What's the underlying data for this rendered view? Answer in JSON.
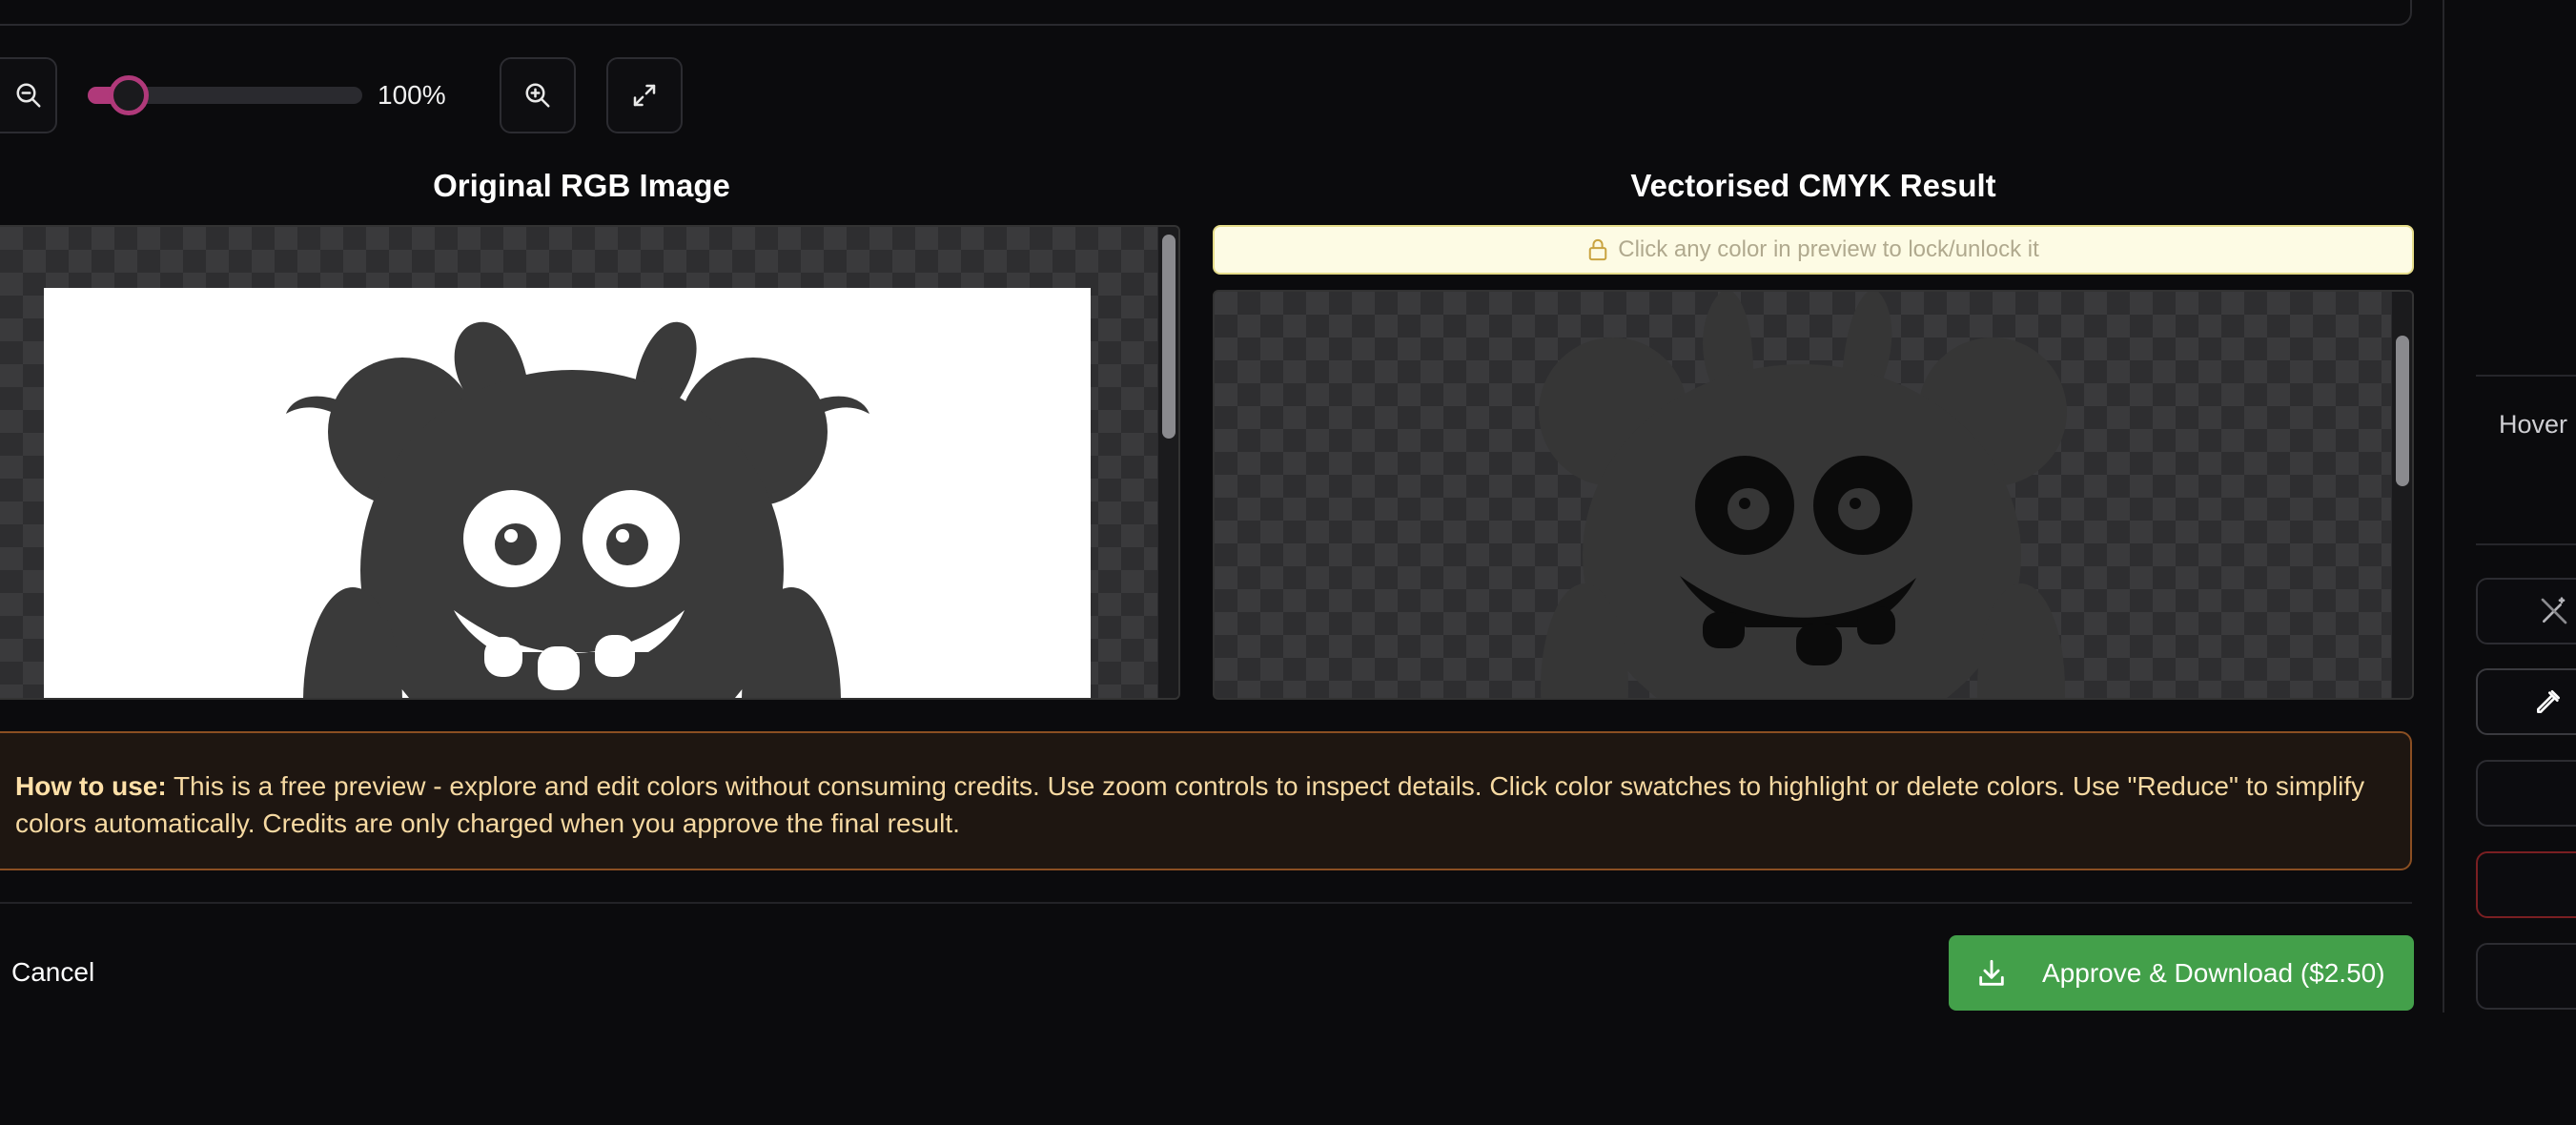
{
  "zoom": {
    "level_text": "100%",
    "level_percent": 100,
    "slider_fraction": 0.15
  },
  "panels": {
    "original_title": "Original RGB Image",
    "result_title": "Vectorised CMYK Result",
    "lock_hint": "Click any color in preview to lock/unlock it"
  },
  "howto": {
    "label": "How to use:",
    "text": "This is a free preview - explore and edit colors without consuming credits. Use zoom controls to inspect details. Click color swatches to highlight or delete colors. Use \"Reduce\" to simplify colors automatically. Credits are only charged when you approve the final result."
  },
  "footer": {
    "cancel_label": "Cancel",
    "approve_label": "Approve & Download ($2.50)"
  },
  "sidebar": {
    "hover_label": "Hover"
  },
  "icons": [
    "zoom-out-icon",
    "zoom-in-icon",
    "fullscreen-icon",
    "lock-icon",
    "download-icon",
    "magic-wand-icon",
    "eyedropper-icon"
  ],
  "colors": {
    "accent": "#b0397a",
    "approve": "#43a04a",
    "monster_dark": "#3a3a3a",
    "hint_bg": "#fdfbe4",
    "howto_border": "#8b4f22"
  }
}
